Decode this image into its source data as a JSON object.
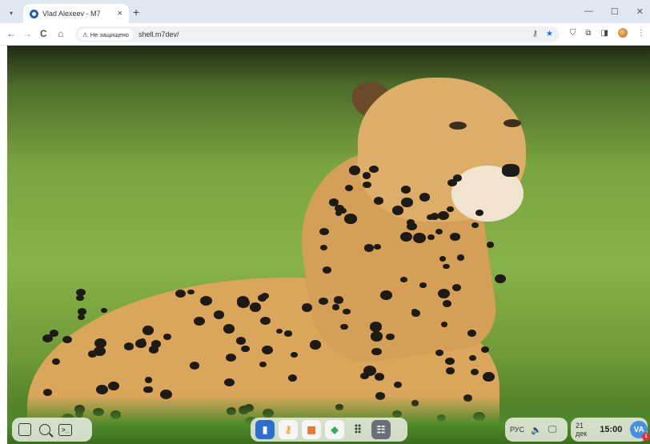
{
  "browser": {
    "tab": {
      "title": "Vlad Alexeev - M7",
      "close_glyph": "×"
    },
    "new_tab_glyph": "+",
    "window_controls": {
      "minimize": "—",
      "maximize": "☐",
      "close": "✕"
    },
    "nav": {
      "back": "←",
      "forward": "→",
      "reload": "C",
      "home": "⌂"
    },
    "security_label": "Не защищено",
    "url": "shell.m7dev/"
  },
  "taskbar": {
    "language": "РУС",
    "date": "21 дек",
    "time": "15:00",
    "user_initials": "VA",
    "notification_count": "1",
    "apps": [
      {
        "name": "files-app-icon",
        "color": "#2d6fd0",
        "glyph": "▮"
      },
      {
        "name": "keys-app-icon",
        "color": "#f0a020",
        "glyph": "🔑"
      },
      {
        "name": "store-app-icon",
        "color": "#e86a1c",
        "glyph": "▦"
      },
      {
        "name": "cube-app-icon",
        "color": "#3aa55a",
        "glyph": "◆"
      },
      {
        "name": "app-grid-icon",
        "color": "transparent",
        "glyph": "⋮⋮⋮"
      },
      {
        "name": "people-app-icon",
        "color": "#6b6f7a",
        "glyph": "☰"
      }
    ]
  },
  "colors": {
    "accent": "#1a73e8",
    "avatar": "#4a8fe0"
  }
}
